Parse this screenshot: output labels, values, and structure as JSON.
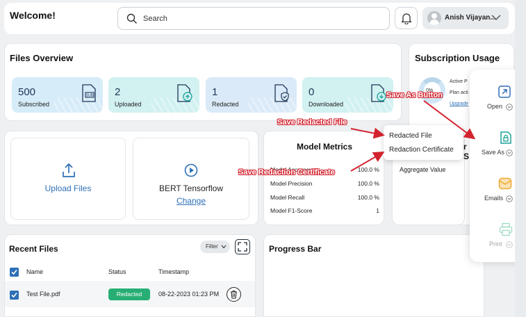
{
  "header": {
    "welcome": "Welcome!",
    "search_placeholder": "Search",
    "user_name": "Anish Vijayan..."
  },
  "files_overview": {
    "title": "Files Overview",
    "stats": [
      {
        "value": "500",
        "label": "Subscribed",
        "color": "#d6ecf8"
      },
      {
        "value": "2",
        "label": "Uploaded",
        "color": "#d2f1f1"
      },
      {
        "value": "1",
        "label": "Redacted",
        "color": "#dbeaf8"
      },
      {
        "value": "0",
        "label": "Downloaded",
        "color": "#d2f1f1"
      }
    ]
  },
  "subscription": {
    "title": "Subscription Usage",
    "donut_label": "0%",
    "active": "Active P",
    "plan": "Plan acti",
    "upgrade": "Upgrade"
  },
  "upload": {
    "label": "Upload Files"
  },
  "model": {
    "name": "BERT Tensorflow",
    "change": "Change"
  },
  "metrics": {
    "title": "Model Metrics",
    "title_fragment": "r S",
    "rows": [
      {
        "label": "Model Accuracy",
        "value": "100.0 %"
      },
      {
        "label": "Model Precision",
        "value": "100.0 %"
      },
      {
        "label": "Model Recall",
        "value": "100.0 %"
      },
      {
        "label": "Model F1-Score",
        "value": "1"
      }
    ],
    "aggregate": "Aggregate Value"
  },
  "recent_files": {
    "title": "Recent Files",
    "filter": "Filter",
    "columns": {
      "name": "Name",
      "status": "Status",
      "timestamp": "Timestamp"
    },
    "rows": [
      {
        "name": "Test File.pdf",
        "status": "Redacted",
        "timestamp": "08-22-2023 01:23 PM"
      }
    ]
  },
  "progress": {
    "title": "Progress Bar"
  },
  "save_menu": {
    "items": [
      "Redacted File",
      "Redaction Certificate"
    ]
  },
  "action_panel": {
    "open": "Open",
    "save_as": "Save As",
    "emails": "Emails",
    "print": "Print"
  },
  "annotations": {
    "save_as_button": "Save As Button",
    "save_redacted_file": "Save Redacted File",
    "save_redaction_certificate": "Save Redaction Certificate"
  },
  "colors": {
    "accent_blue": "#2d6fb6",
    "teal": "#1aa39a",
    "status_green": "#27ae74",
    "email_orange": "#f0a830",
    "annotation_red": "#d3232f"
  }
}
